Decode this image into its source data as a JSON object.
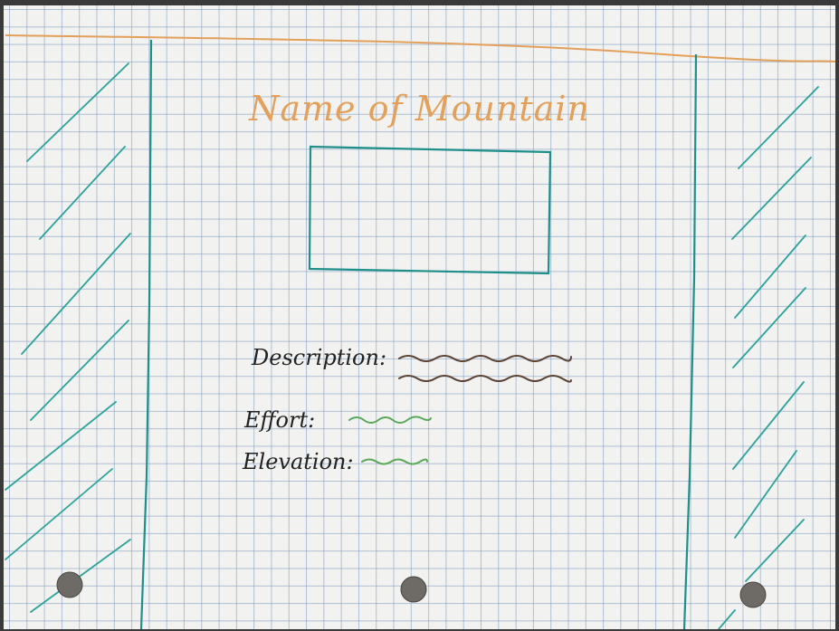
{
  "title": "Name of Mountain",
  "fields": {
    "description_label": "Description:",
    "effort_label": "Effort:",
    "elevation_label": "Elevation:"
  },
  "colors": {
    "paper": "#f2f2f0",
    "grid": "#7896be",
    "title_ink": "#e3a05a",
    "frame_ink": "#1f8f8a",
    "description_ink": "#5a4334",
    "value_ink": "#5aa85a",
    "label_ink": "#222222"
  }
}
